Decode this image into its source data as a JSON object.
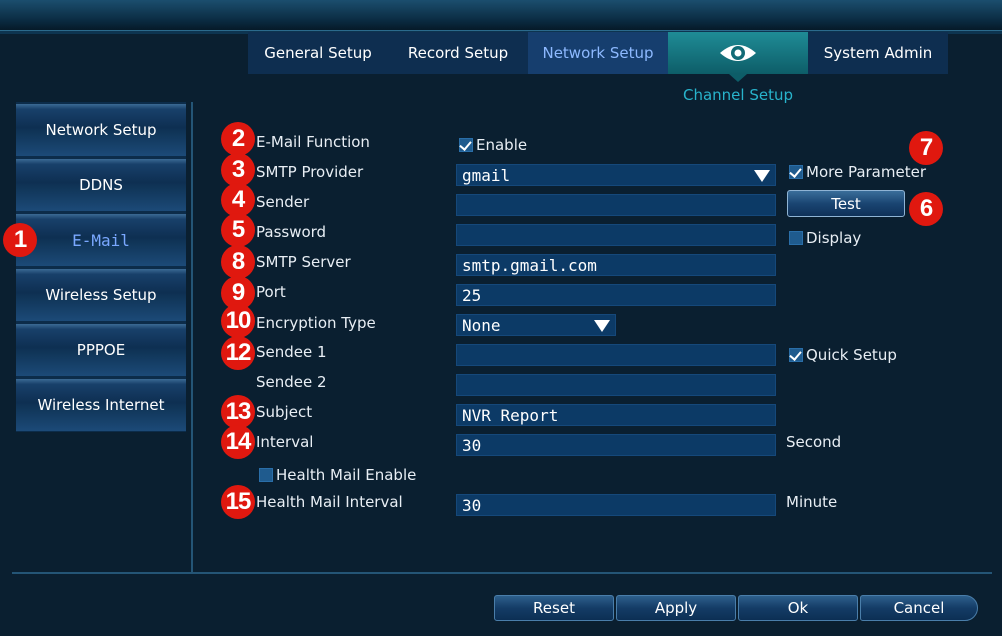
{
  "top_tabs": [
    {
      "label": "General Setup"
    },
    {
      "label": "Record Setup"
    },
    {
      "label": "Network Setup"
    },
    {
      "label": "System Admin"
    }
  ],
  "channel_setup_label": "Channel Setup",
  "sidebar": {
    "items": [
      {
        "label": "Network Setup"
      },
      {
        "label": "DDNS"
      },
      {
        "label": "E-Mail"
      },
      {
        "label": "Wireless Setup"
      },
      {
        "label": "PPPOE"
      },
      {
        "label": "Wireless Internet"
      }
    ]
  },
  "badges": [
    "1",
    "2",
    "3",
    "4",
    "5",
    "6",
    "7",
    "8",
    "9",
    "10",
    "12",
    "13",
    "14",
    "15"
  ],
  "form": {
    "email_function": {
      "label": "E-Mail Function",
      "checkbox_label": "Enable",
      "checked": true
    },
    "smtp_provider": {
      "label": "SMTP Provider",
      "value": "gmail"
    },
    "sender": {
      "label": "Sender",
      "value": ""
    },
    "password": {
      "label": "Password",
      "value": ""
    },
    "smtp_server": {
      "label": "SMTP Server",
      "value": "smtp.gmail.com"
    },
    "port": {
      "label": "Port",
      "value": "25"
    },
    "encryption": {
      "label": "Encryption Type",
      "value": "None"
    },
    "sendee1": {
      "label": "Sendee 1",
      "value": ""
    },
    "sendee2": {
      "label": "Sendee 2",
      "value": ""
    },
    "subject": {
      "label": "Subject",
      "value": "NVR Report"
    },
    "interval": {
      "label": "Interval",
      "value": "30",
      "unit": "Second"
    },
    "health_mail_enable": {
      "label": "Health Mail Enable",
      "checked": false
    },
    "health_interval": {
      "label": "Health Mail Interval",
      "value": "30",
      "unit": "Minute"
    },
    "more_parameter": {
      "label": "More Parameter",
      "checked": true
    },
    "test_button": "Test",
    "display": {
      "label": "Display",
      "checked": false
    },
    "quick_setup": {
      "label": "Quick Setup",
      "checked": true
    }
  },
  "footer": {
    "reset": "Reset",
    "apply": "Apply",
    "ok": "Ok",
    "cancel": "Cancel"
  },
  "colors": {
    "badge": "#e0180f",
    "accent_tab": "#1f8c96",
    "active_text": "#7aa8ff"
  },
  "icons": {
    "channel_setup": "eye-icon",
    "dropdown": "triangle-down-icon",
    "checkbox": "checkmark-icon"
  }
}
